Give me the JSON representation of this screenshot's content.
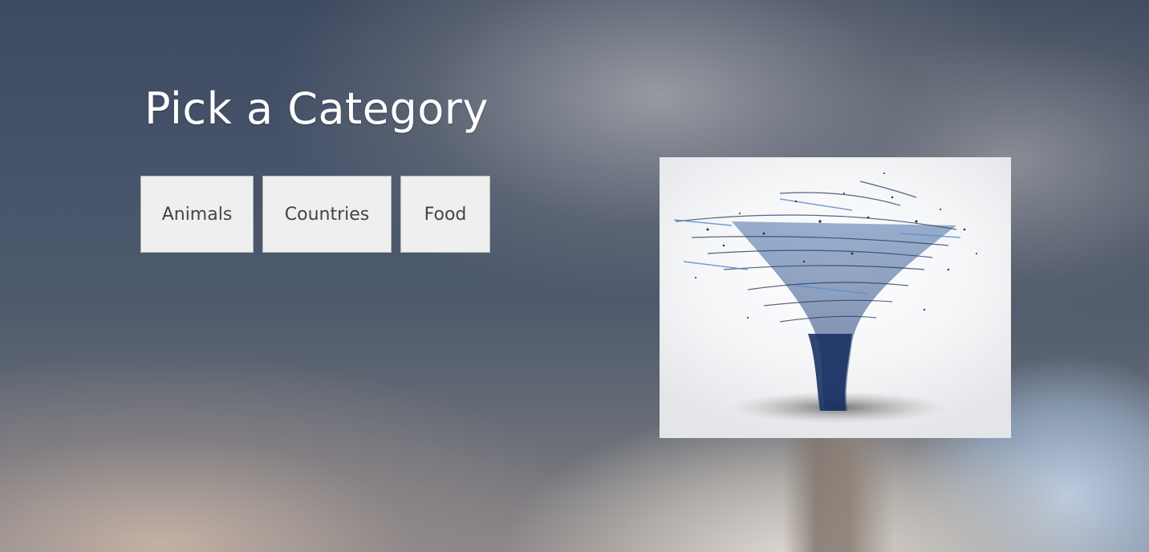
{
  "page": {
    "heading": "Pick a Category"
  },
  "categories": [
    {
      "label": "Animals"
    },
    {
      "label": "Countries"
    },
    {
      "label": "Food"
    }
  ],
  "colors": {
    "heading_text": "#ffffff",
    "button_bg": "#efefef",
    "button_text": "#444444",
    "tornado_blue": "#2a4e8a"
  },
  "icons": {
    "illustration": "tornado-illustration"
  }
}
